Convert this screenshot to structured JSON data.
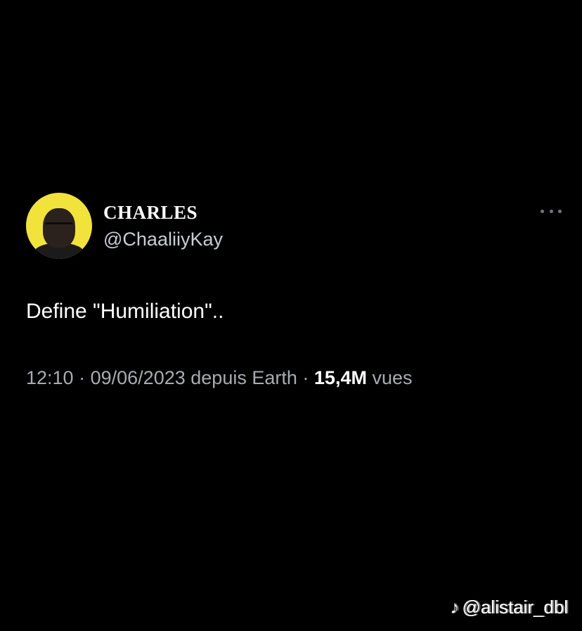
{
  "tweet": {
    "display_name": "CHARLES",
    "handle": "@ChaaliiyKay",
    "text": "Define \"Humiliation\"..",
    "time": "12:10",
    "date": "09/06/2023",
    "source": "depuis Earth",
    "views_count": "15,4M",
    "views_label": "vues",
    "separator": "·",
    "more_icon": "more-horizontal-icon"
  },
  "watermark": {
    "icon": "tiktok-icon",
    "username": "@alistair_dbl"
  },
  "colors": {
    "background": "#000000",
    "avatar_bg": "#f2e33a",
    "secondary_text": "#a8acb1"
  }
}
